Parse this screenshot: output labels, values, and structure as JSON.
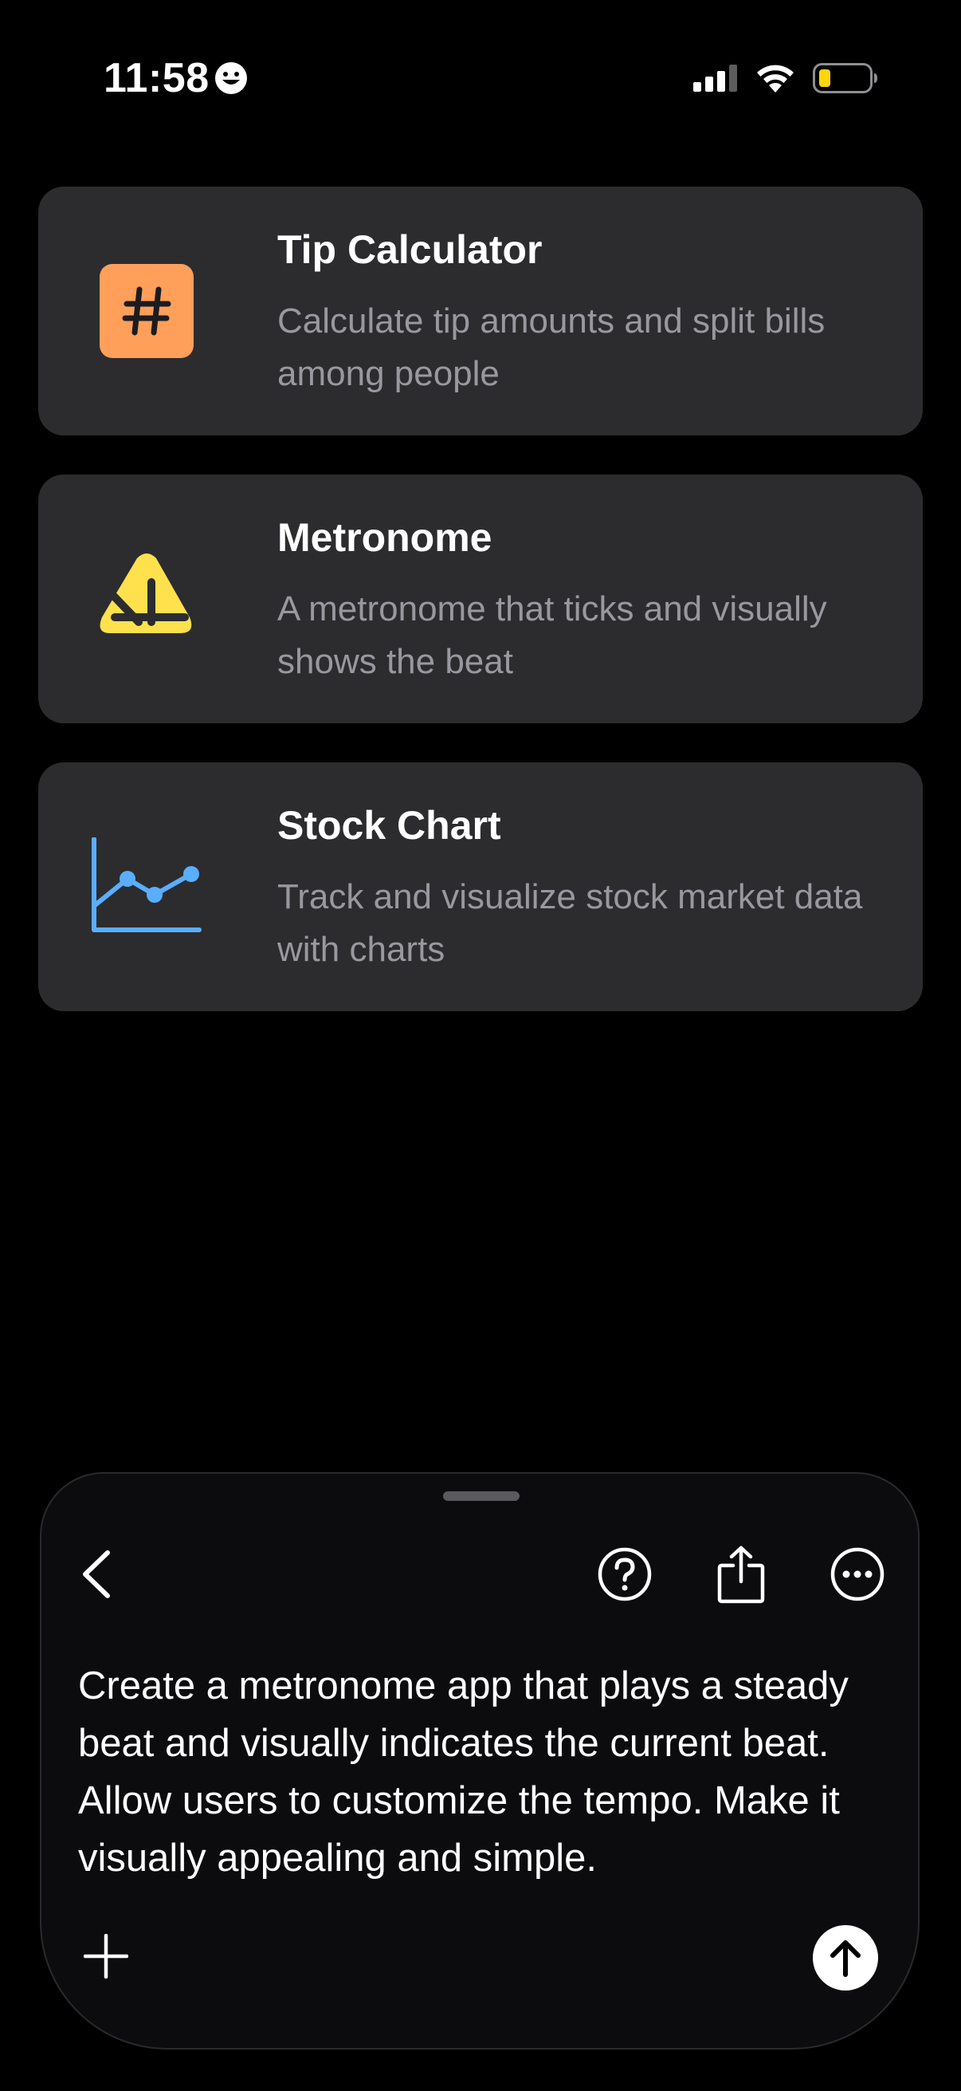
{
  "status_bar": {
    "time": "11:58",
    "icons": [
      "emoji-smile-icon",
      "cellular-signal-icon",
      "wifi-icon",
      "battery-low-icon"
    ],
    "battery_color": "#ffd60a"
  },
  "apps": [
    {
      "title": "Tip Calculator",
      "description": "Calculate tip amounts and split bills among people",
      "icon": "hash-icon",
      "icon_color": "#ff9f5a"
    },
    {
      "title": "Metronome",
      "description": "A metronome that ticks and visually shows the beat",
      "icon": "metronome-icon",
      "icon_color": "#ffe14d"
    },
    {
      "title": "Stock Chart",
      "description": "Track and visualize stock market data with charts",
      "icon": "line-chart-icon",
      "icon_color": "#5aaeff"
    }
  ],
  "composer": {
    "toolbar_icons": [
      "back-chevron-icon",
      "help-icon",
      "share-icon",
      "more-icon"
    ],
    "prompt": "Create a metronome app that plays a steady beat and visually indicates the current beat. Allow users to customize the tempo. Make it visually appealing and simple.",
    "add_icon": "plus-icon",
    "send_icon": "arrow-up-icon"
  }
}
